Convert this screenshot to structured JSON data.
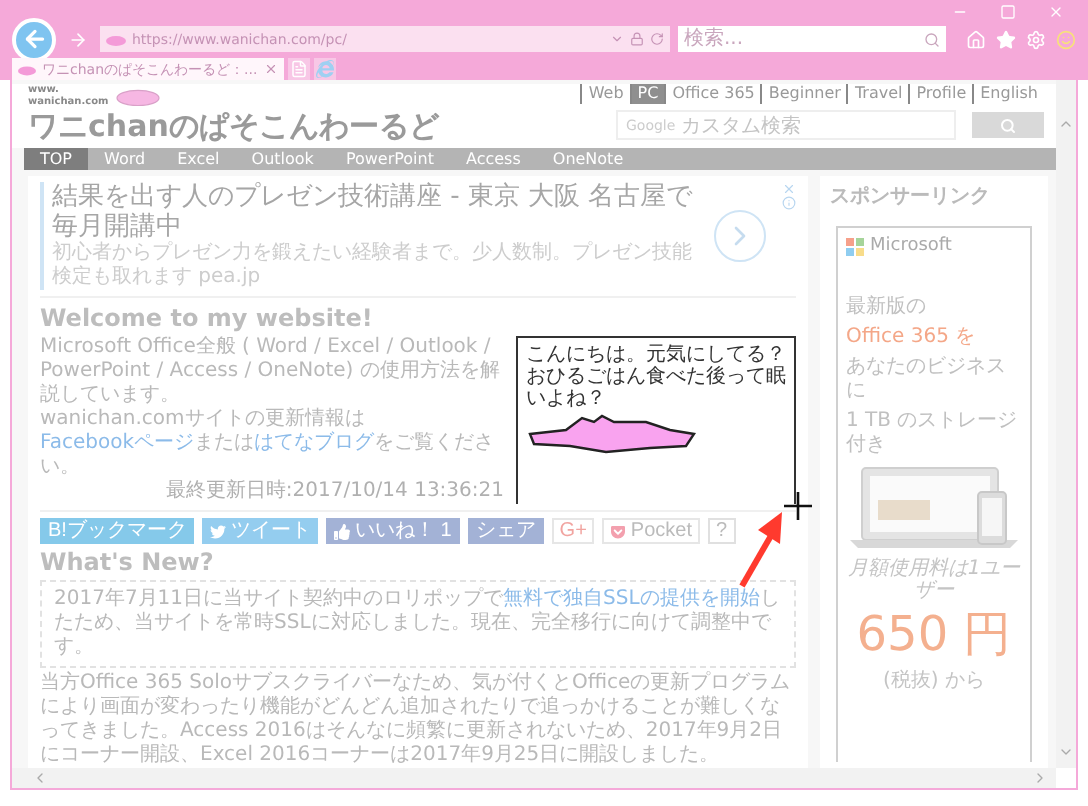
{
  "browser": {
    "address": "https://www.wanichan.com/pc/",
    "search_placeholder": "検索...",
    "tabs": [
      {
        "label": "ワニchanのぱそこんわーるど：...",
        "selected": true
      }
    ]
  },
  "site": {
    "logo_small": [
      "www.",
      "wanichan.com"
    ],
    "logo_title": "ワニchanのぱそこんわーるど",
    "top_links": [
      {
        "label": "Web",
        "selected": false
      },
      {
        "label": "PC",
        "selected": true
      },
      {
        "label": "Office 365",
        "selected": false
      },
      {
        "label": "Beginner",
        "selected": false
      },
      {
        "label": "Travel",
        "selected": false
      },
      {
        "label": "Profile",
        "selected": false
      },
      {
        "label": "English",
        "selected": false
      }
    ],
    "search": {
      "brand": "Google",
      "placeholder": "カスタム検索"
    },
    "nav": [
      {
        "label": "TOP",
        "selected": true
      },
      {
        "label": "Word",
        "selected": false
      },
      {
        "label": "Excel",
        "selected": false
      },
      {
        "label": "Outlook",
        "selected": false
      },
      {
        "label": "PowerPoint",
        "selected": false
      },
      {
        "label": "Access",
        "selected": false
      },
      {
        "label": "OneNote",
        "selected": false
      }
    ]
  },
  "ad": {
    "headline": "結果を出す人のプレゼン技術講座 - 東京 大阪 名古屋で毎月開講中",
    "description": "初心者からプレゼン力を鍛えたい経験者まで。少人数制。プレゼン技能検定も取れます pea.jp"
  },
  "welcome": {
    "heading": "Welcome to my website!",
    "paragraphs": [
      [
        {
          "kind": "text",
          "text": "Microsoft Office全般 ( Word / Excel / Outlook / PowerPoint / Access / OneNote) の使用方法を解説しています。"
        }
      ],
      [
        {
          "kind": "text",
          "text": "wanichan.comサイトの更新情報は"
        },
        {
          "kind": "link",
          "text": "Facebookページ"
        },
        {
          "kind": "text",
          "text": "または"
        },
        {
          "kind": "link",
          "text": "はてなブログ"
        },
        {
          "kind": "text",
          "text": "をご覧ください。"
        }
      ]
    ],
    "updated": "最終更新日時:2017/10/14 13:36:21"
  },
  "overlay_image": {
    "lines": [
      "こんにちは。元気にしてる？",
      "おひるごはん食べた後って眠いよね？"
    ]
  },
  "share_buttons": [
    {
      "kind": "hatena",
      "label": "B!ブックマーク"
    },
    {
      "kind": "twitter",
      "label": "ツイート"
    },
    {
      "kind": "like",
      "label": "いいね！ 1"
    },
    {
      "kind": "share",
      "label": "シェア"
    },
    {
      "kind": "google",
      "label": "G+"
    },
    {
      "kind": "pocket",
      "label": "Pocket"
    },
    {
      "kind": "count",
      "label": "?"
    }
  ],
  "whats_new": {
    "heading": "What's New?",
    "notice": [
      {
        "kind": "text",
        "text": "2017年7月11日に当サイト契約中のロリポップで"
      },
      {
        "kind": "link",
        "text": "無料で独自SSLの提供を開始"
      },
      {
        "kind": "text",
        "text": "したため、当サイトを常時SSLに対応しました。現在、完全移行に向けて調整中です。"
      }
    ],
    "text": "当方Office 365 Soloサブスクライバーなため、気が付くとOfficeの更新プログラムにより画面が変わったり機能がどんどん追加されたりで追っかけることが難しくなってきました。Access 2016はそんなに頻繁に更新されないため、2017年9月2日にコーナー開設、Excel 2016コーナーは2017年9月25日に開設しました。"
  },
  "sidebar": {
    "heading": "スポンサーリンク",
    "ad": {
      "brand": "Microsoft",
      "lines": [
        {
          "text": "最新版の",
          "highlight": false
        },
        {
          "text": "Office 365 を",
          "highlight": true
        },
        {
          "text": "あなたのビジネスに",
          "highlight": false
        }
      ],
      "note": "1 TB のストレージ付き",
      "price_caption": "月額使用料は1ユーザー",
      "price": "650 円",
      "price_note": "(税抜) から"
    }
  }
}
